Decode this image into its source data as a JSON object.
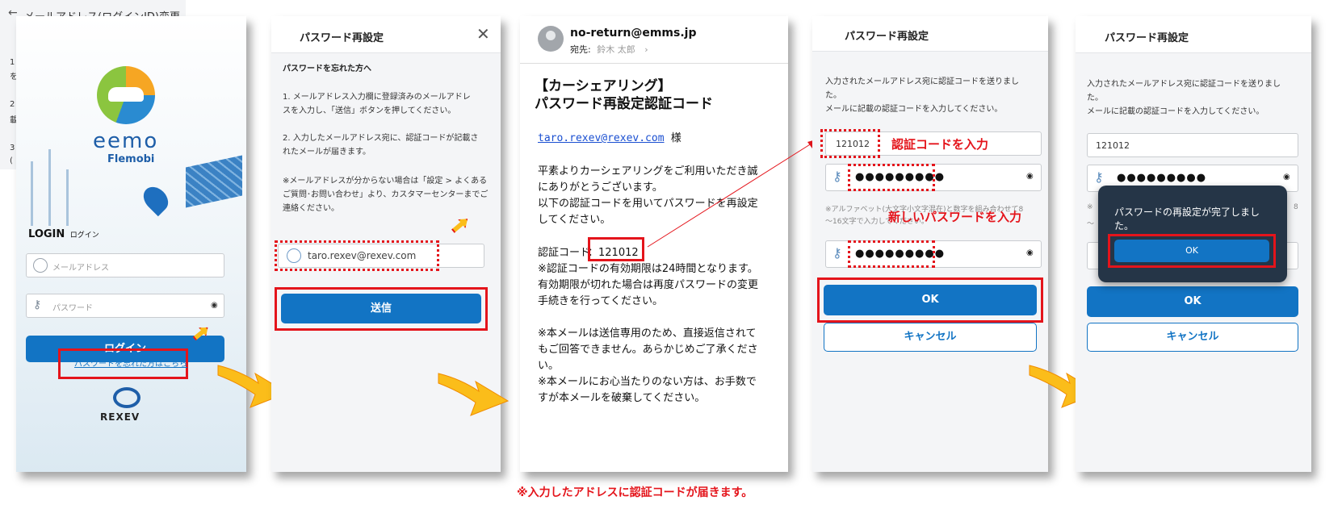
{
  "background_fragment": {
    "title": "メールアドレス(ログインID)変更",
    "side_chars": [
      "1",
      "を",
      "2",
      "載",
      "3",
      "("
    ]
  },
  "login": {
    "brand": "eemo",
    "brand_sub": "Flemobi",
    "login_label": "LOGIN",
    "login_sub": "ログイン",
    "email_placeholder": "メールアドレス",
    "password_placeholder": "パスワード",
    "login_button": "ログイン",
    "forgot_link": "パスワードを忘れた方はこちら",
    "company": "REXEV"
  },
  "reset": {
    "title": "パスワード再設定",
    "heading": "パスワードを忘れた方へ",
    "step1_line1": "1. メールアドレス入力欄に登録済みのメールアドレ",
    "step1_line2": "スを入力し、「送信」ボタンを押してください。",
    "step2_line1": "2. 入力したメールアドレス宛に、認証コードが記載さ",
    "step2_line2": "れたメールが届きます。",
    "note_line1": "※メールアドレスが分からない場合は「設定 > よくある",
    "note_line2": "ご質問･お問い合わせ」より、カスタマーセンターまでご",
    "note_line3": "連絡ください。",
    "email_value": "taro.rexev@rexev.com",
    "send_button": "送信"
  },
  "email": {
    "from": "no-return@emms.jp",
    "to_label": "宛先:",
    "to_name": "鈴木 太郎",
    "subject_line1": "【カーシェアリング】",
    "subject_line2": "パスワード再設定認証コード",
    "recipient": "taro.rexev@rexev.com",
    "honorific": "様",
    "body_line1": "平素よりカーシェアリングをご利用いただき誠",
    "body_line2": "にありがとうございます。",
    "body_line3": "以下の認証コードを用いてパスワードを再設定",
    "body_line4": "してください。",
    "code_label": "認証コード",
    "code_value": "：121012",
    "exp_line1": "※認証コードの有効期限は24時間となります。",
    "exp_line2": "有効期限が切れた場合は再度パスワードの変更",
    "exp_line3": "手続きを行ってください。",
    "note_line1": "※本メールは送信専用のため、直接返信されて",
    "note_line2": "もご回答できません。あらかじめご了承くださ",
    "note_line3": "い。",
    "note_line4": "※本メールにお心当たりのない方は、お手数で",
    "note_line5": "すが本メールを破棄してください。",
    "caption": "※入力したアドレスに認証コードが届きます。"
  },
  "verify": {
    "title": "パスワード再設定",
    "info_line1": "入力されたメールアドレス宛に認証コードを送りまし",
    "info_line2": "た。",
    "info_line3": "メールに記載の認証コードを入力してください。",
    "code_value": "121012",
    "code_annotation": "認証コードを入力",
    "password_dots": "●●●●●●●●●",
    "rule_line1": "※アルファベット(大文字小文字混在)と数字を組み合わせて8",
    "rule_line2": "～16文字で入力してください。",
    "new_password_annotation": "新しいパスワードを入力",
    "ok_button": "OK",
    "cancel_button": "キャンセル"
  },
  "done": {
    "title": "パスワード再設定",
    "info_line1": "入力されたメールアドレス宛に認証コードを送りまし",
    "info_line2": "た。",
    "info_line3": "メールに記載の認証コードを入力してください。",
    "code_value": "121012",
    "password_dots": "●●●●●●●●●",
    "dialog_line1": "パスワードの再設定が完了しまし",
    "dialog_line2": "た。",
    "dialog_ok": "OK",
    "ok_button": "OK",
    "cancel_button": "キャンセル",
    "rule_fragment": "※",
    "rule_fragment2": "8",
    "rule_fragment3": "～"
  },
  "colors": {
    "accent_blue": "#1274c4",
    "annotation_red": "#e4141b",
    "arrow_yellow": "#fbbd1a",
    "dialog_bg": "#253547"
  }
}
